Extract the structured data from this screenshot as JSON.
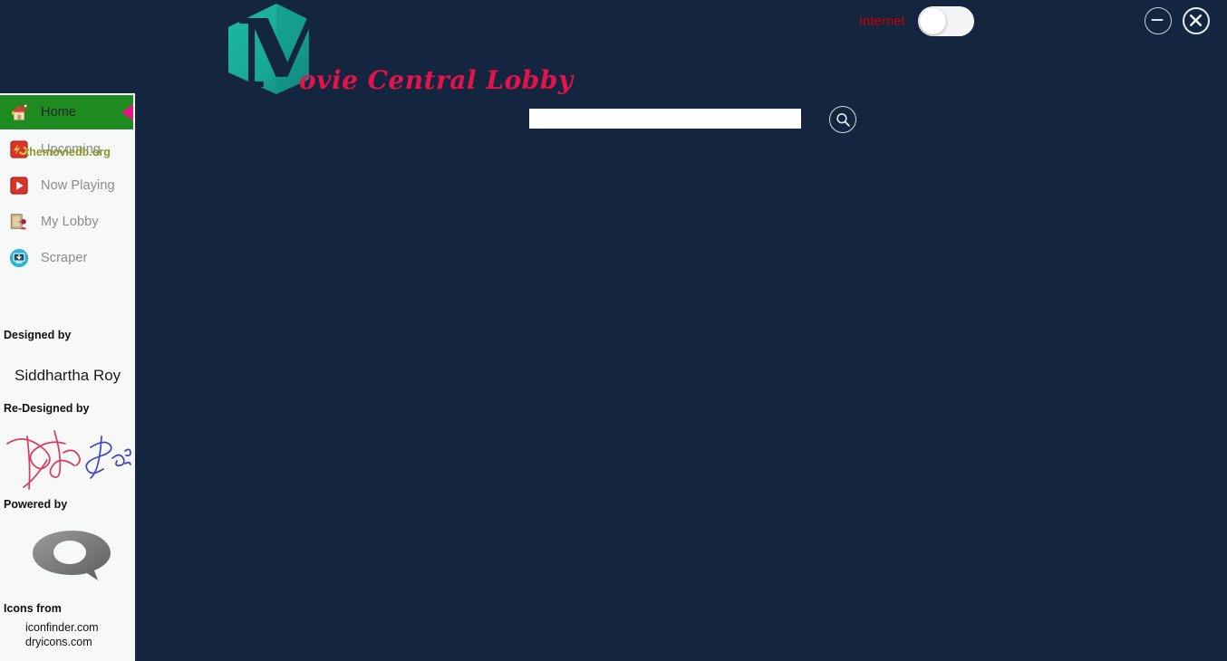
{
  "app": {
    "title": "Movie Central Lobby",
    "logo_letter": "M",
    "title_rest": "ovie Central Lobby",
    "background_color": "#13253f",
    "accent_color": "#e2144b"
  },
  "titlebar": {
    "internet_label": "Internet",
    "internet_toggle_state": "off",
    "minimize_icon": "minimize-icon",
    "close_icon": "close-icon"
  },
  "search": {
    "value": "",
    "placeholder": "",
    "button_icon": "search-icon"
  },
  "sidebar": {
    "items": [
      {
        "label": "Home",
        "icon": "home-icon",
        "active": true
      },
      {
        "label": "Upcoming",
        "icon": "upcoming-icon",
        "active": false
      },
      {
        "label": "Now Playing",
        "icon": "play-icon",
        "active": false
      },
      {
        "label": "My Lobby",
        "icon": "lobby-icon",
        "active": false
      },
      {
        "label": "Scraper",
        "icon": "scraper-icon",
        "active": false
      }
    ],
    "credits": {
      "designed_by_label": "Designed by",
      "designer_name": "Siddhartha Roy",
      "redesigned_by_label": "Re-Designed by",
      "redesigner_signature": "Partha Sai",
      "powered_by_label": "Powered by",
      "powered_by_name": "themoviedb.org",
      "icons_from_label": "Icons from",
      "icon_sources": [
        "iconfinder.com",
        "dryicons.com"
      ]
    }
  }
}
